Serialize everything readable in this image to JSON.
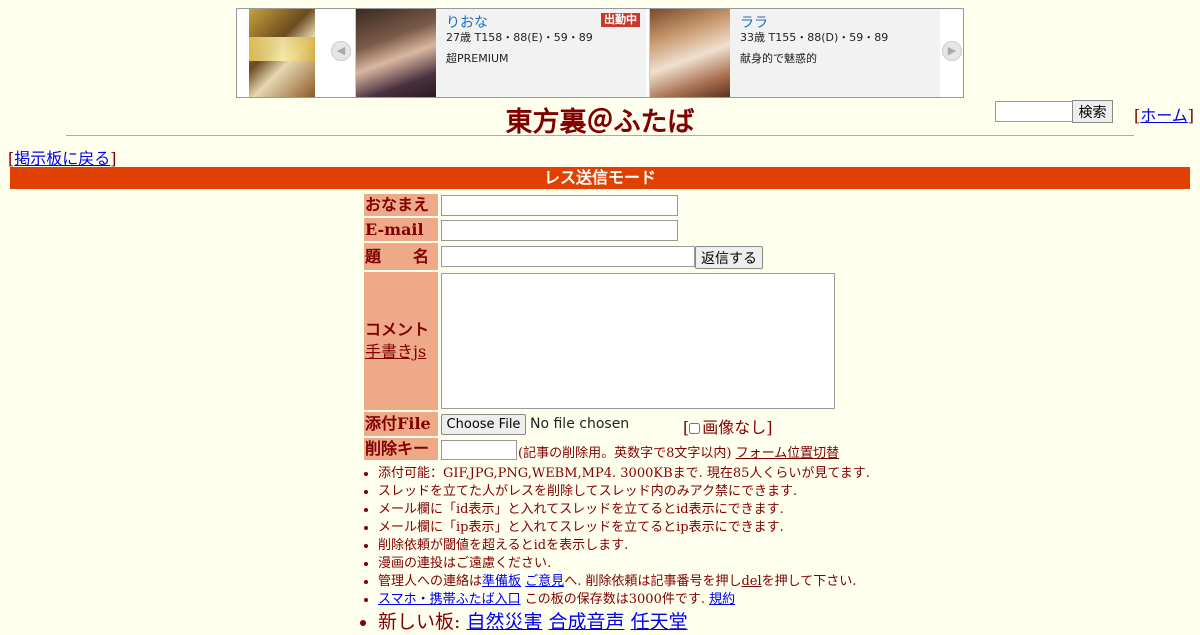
{
  "banner": {
    "cards": [
      {
        "name": "りおな",
        "spec": "27歳 T158・88(E)・59・89",
        "desc": "超PREMIUM",
        "badge": "出勤中"
      },
      {
        "name": "ララ",
        "spec": "33歳 T155・88(D)・59・89",
        "desc": "献身的で魅惑的",
        "badge": ""
      }
    ],
    "prev_arrow": "◀",
    "next_arrow": "▶"
  },
  "header": {
    "title": "東方裏＠ふたば",
    "search_button": "検索",
    "home_link": "ホーム",
    "back_link": "掲示板に戻る"
  },
  "mode_bar": "レス送信モード",
  "form": {
    "name_label": "おなまえ",
    "email_label": "E-mail",
    "subject_label": "題　　名",
    "reply_button": "返信する",
    "comment_label": "コメント",
    "handwrite_link": "手書きjs",
    "file_label": "添付File",
    "choose_file_button": "Choose File",
    "no_file_text": "No file chosen",
    "no_image_label": "画像なし",
    "delkey_label": "削除キー",
    "delkey_note": "(記事の削除用。英数字で8文字以内)",
    "form_toggle_link": "フォーム位置切替"
  },
  "notes": {
    "n1": "添付可能：GIF,JPG,PNG,WEBM,MP4. 3000KBまで. 現在85人くらいが見てます.",
    "n2": "スレッドを立てた人がレスを削除してスレッド内のみアク禁にできます.",
    "n3": "メール欄に「id表示」と入れてスレッドを立てるとid表示にできます.",
    "n4": "メール欄に「ip表示」と入れてスレッドを立てるとip表示にできます.",
    "n5": "削除依頼が閾値を超えるとidを表示します.",
    "n6": "漫画の連投はご遠慮ください.",
    "n7_pre": "管理人への連絡は",
    "n7_link1": "準備板",
    "n7_link2": "ご意見",
    "n7_mid": "へ. 削除依頼は記事番号を押し",
    "n7_del": "del",
    "n7_post": "を押して下さい.",
    "n8_link": "スマホ・携帯ふたば入口",
    "n8_mid": " この板の保存数は3000件です.",
    "n8_rules": "規約",
    "n9_pre": "新しい板: ",
    "n9_boards": [
      "自然災害",
      "合成音声",
      "任天堂"
    ]
  }
}
